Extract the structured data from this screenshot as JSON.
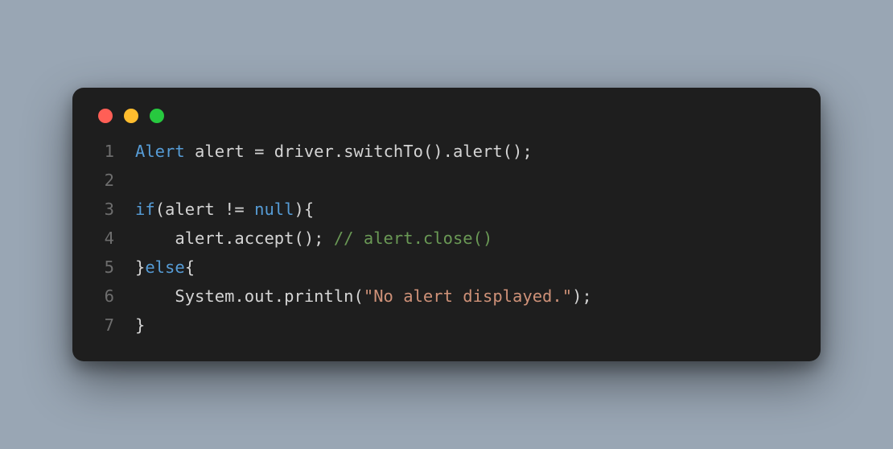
{
  "lines": [
    {
      "num": "1",
      "tokens": [
        {
          "cls": "tok-type",
          "text": "Alert"
        },
        {
          "cls": "tok-ident",
          "text": " alert "
        },
        {
          "cls": "tok-punct",
          "text": "= driver.switchTo().alert();"
        }
      ]
    },
    {
      "num": "2",
      "tokens": [
        {
          "cls": "tok-ident",
          "text": ""
        }
      ]
    },
    {
      "num": "3",
      "tokens": [
        {
          "cls": "tok-keyword",
          "text": "if"
        },
        {
          "cls": "tok-punct",
          "text": "(alert != "
        },
        {
          "cls": "tok-null",
          "text": "null"
        },
        {
          "cls": "tok-punct",
          "text": "){"
        }
      ]
    },
    {
      "num": "4",
      "tokens": [
        {
          "cls": "tok-ident",
          "text": "    alert.accept(); "
        },
        {
          "cls": "tok-comment",
          "text": "// alert.close()"
        }
      ]
    },
    {
      "num": "5",
      "tokens": [
        {
          "cls": "tok-punct",
          "text": "}"
        },
        {
          "cls": "tok-keyword",
          "text": "else"
        },
        {
          "cls": "tok-punct",
          "text": "{"
        }
      ]
    },
    {
      "num": "6",
      "tokens": [
        {
          "cls": "tok-ident",
          "text": "    System.out.println("
        },
        {
          "cls": "tok-string",
          "text": "\"No alert displayed.\""
        },
        {
          "cls": "tok-punct",
          "text": ");"
        }
      ]
    },
    {
      "num": "7",
      "tokens": [
        {
          "cls": "tok-punct",
          "text": "}"
        }
      ]
    }
  ]
}
